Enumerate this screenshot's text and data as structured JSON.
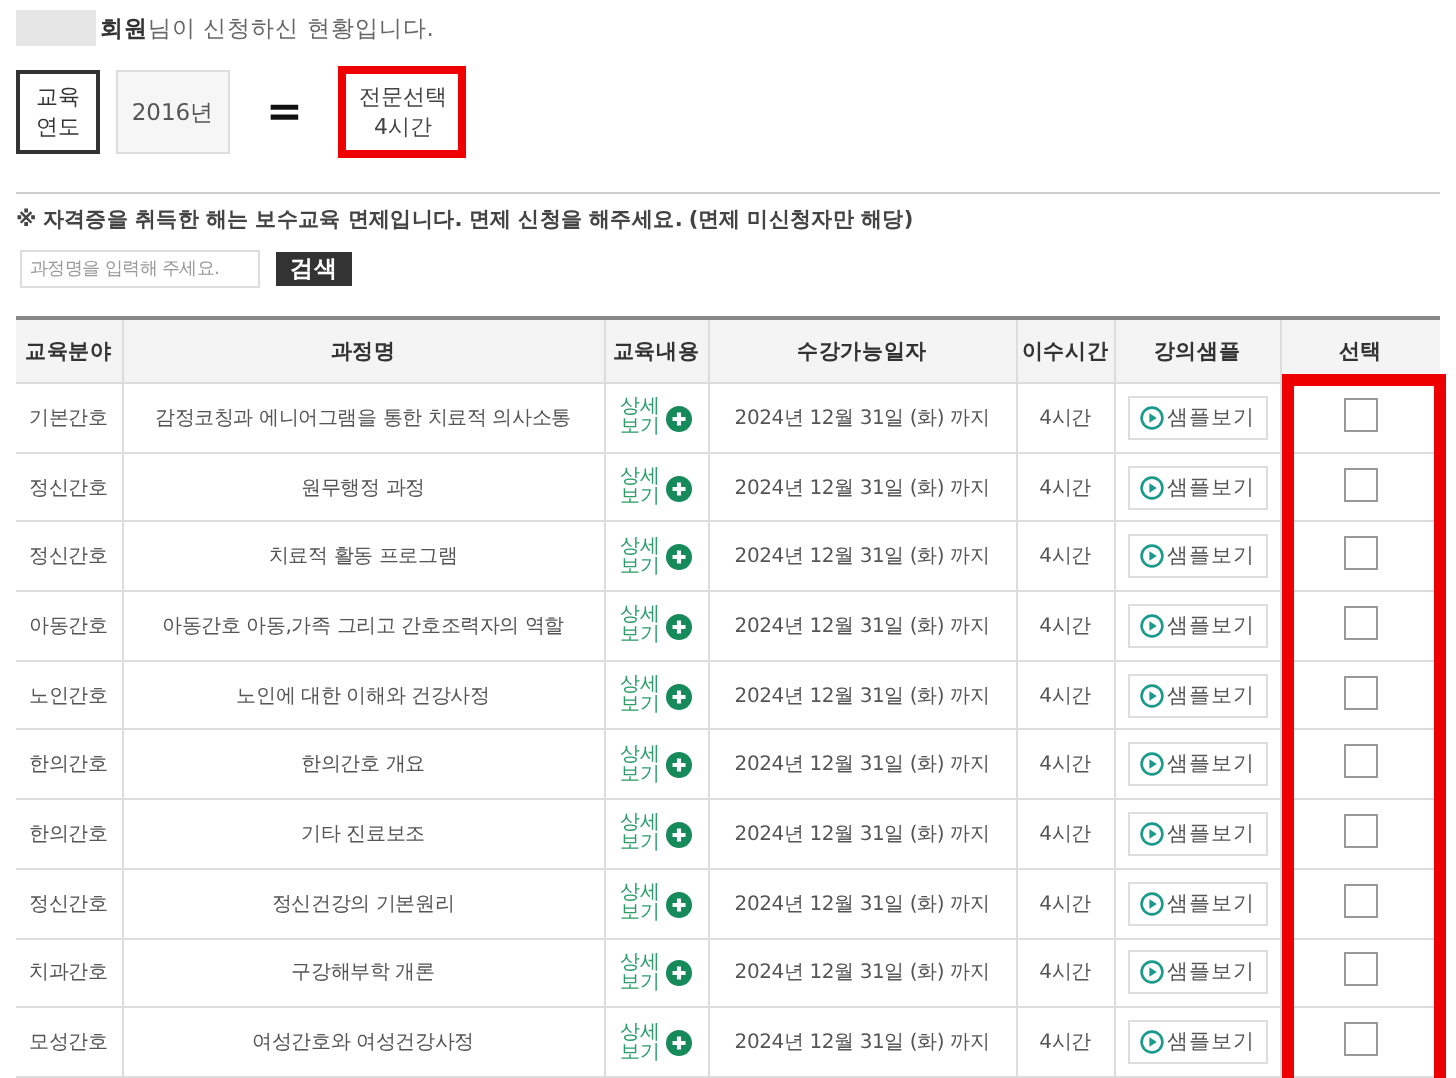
{
  "greeting": {
    "redacted_name": true,
    "text": "**회원**님이 신청하신 현황입니다."
  },
  "summary": {
    "year_label": [
      "교육",
      "연도"
    ],
    "year_value": "2016년",
    "equals": "=",
    "result_lines": [
      "전문선택",
      "4시간"
    ],
    "result_highlighted": true
  },
  "notice": "※ 자격증을 취득한 해는 보수교육 면제입니다. 면제 신청을 해주세요. (면제 미신청자만 해당)",
  "search": {
    "placeholder": "과정명을 입력해 주세요.",
    "button": "검색"
  },
  "table": {
    "columns": [
      "교육분야",
      "과정명",
      "교육내용",
      "수강가능일자",
      "이수시간",
      "강의샘플",
      "선택"
    ],
    "select_column_highlighted": true,
    "rows": [
      {
        "field": "기본간호",
        "course": "감정코칭과 에니어그램을 통한 치료적 의사소통",
        "detail": "상세보기",
        "period": "2024년 12월 31일 (화) 까지",
        "hours": "4시간",
        "sample": "샘플보기",
        "checked": false
      },
      {
        "field": "정신간호",
        "course": "원무행정 과정",
        "detail": "상세보기",
        "period": "2024년 12월 31일 (화) 까지",
        "hours": "4시간",
        "sample": "샘플보기",
        "checked": false
      },
      {
        "field": "정신간호",
        "course": "치료적 활동 프로그램",
        "detail": "상세보기",
        "period": "2024년 12월 31일 (화) 까지",
        "hours": "4시간",
        "sample": "샘플보기",
        "checked": false
      },
      {
        "field": "아동간호",
        "course": "아동간호 아동,가족 그리고 간호조력자의 역할",
        "detail": "상세보기",
        "period": "2024년 12월 31일 (화) 까지",
        "hours": "4시간",
        "sample": "샘플보기",
        "checked": false
      },
      {
        "field": "노인간호",
        "course": "노인에 대한 이해와 건강사정",
        "detail": "상세보기",
        "period": "2024년 12월 31일 (화) 까지",
        "hours": "4시간",
        "sample": "샘플보기",
        "checked": false
      },
      {
        "field": "한의간호",
        "course": "한의간호 개요",
        "detail": "상세보기",
        "period": "2024년 12월 31일 (화) 까지",
        "hours": "4시간",
        "sample": "샘플보기",
        "checked": false
      },
      {
        "field": "한의간호",
        "course": "기타 진료보조",
        "detail": "상세보기",
        "period": "2024년 12월 31일 (화) 까지",
        "hours": "4시간",
        "sample": "샘플보기",
        "checked": false
      },
      {
        "field": "정신간호",
        "course": "정신건강의 기본원리",
        "detail": "상세보기",
        "period": "2024년 12월 31일 (화) 까지",
        "hours": "4시간",
        "sample": "샘플보기",
        "checked": false
      },
      {
        "field": "치과간호",
        "course": "구강해부학 개론",
        "detail": "상세보기",
        "period": "2024년 12월 31일 (화) 까지",
        "hours": "4시간",
        "sample": "샘플보기",
        "checked": false
      },
      {
        "field": "모성간호",
        "course": "여성간호와 여성건강사정",
        "detail": "상세보기",
        "period": "2024년 12월 31일 (화) 까지",
        "hours": "4시간",
        "sample": "샘플보기",
        "checked": false
      }
    ]
  }
}
